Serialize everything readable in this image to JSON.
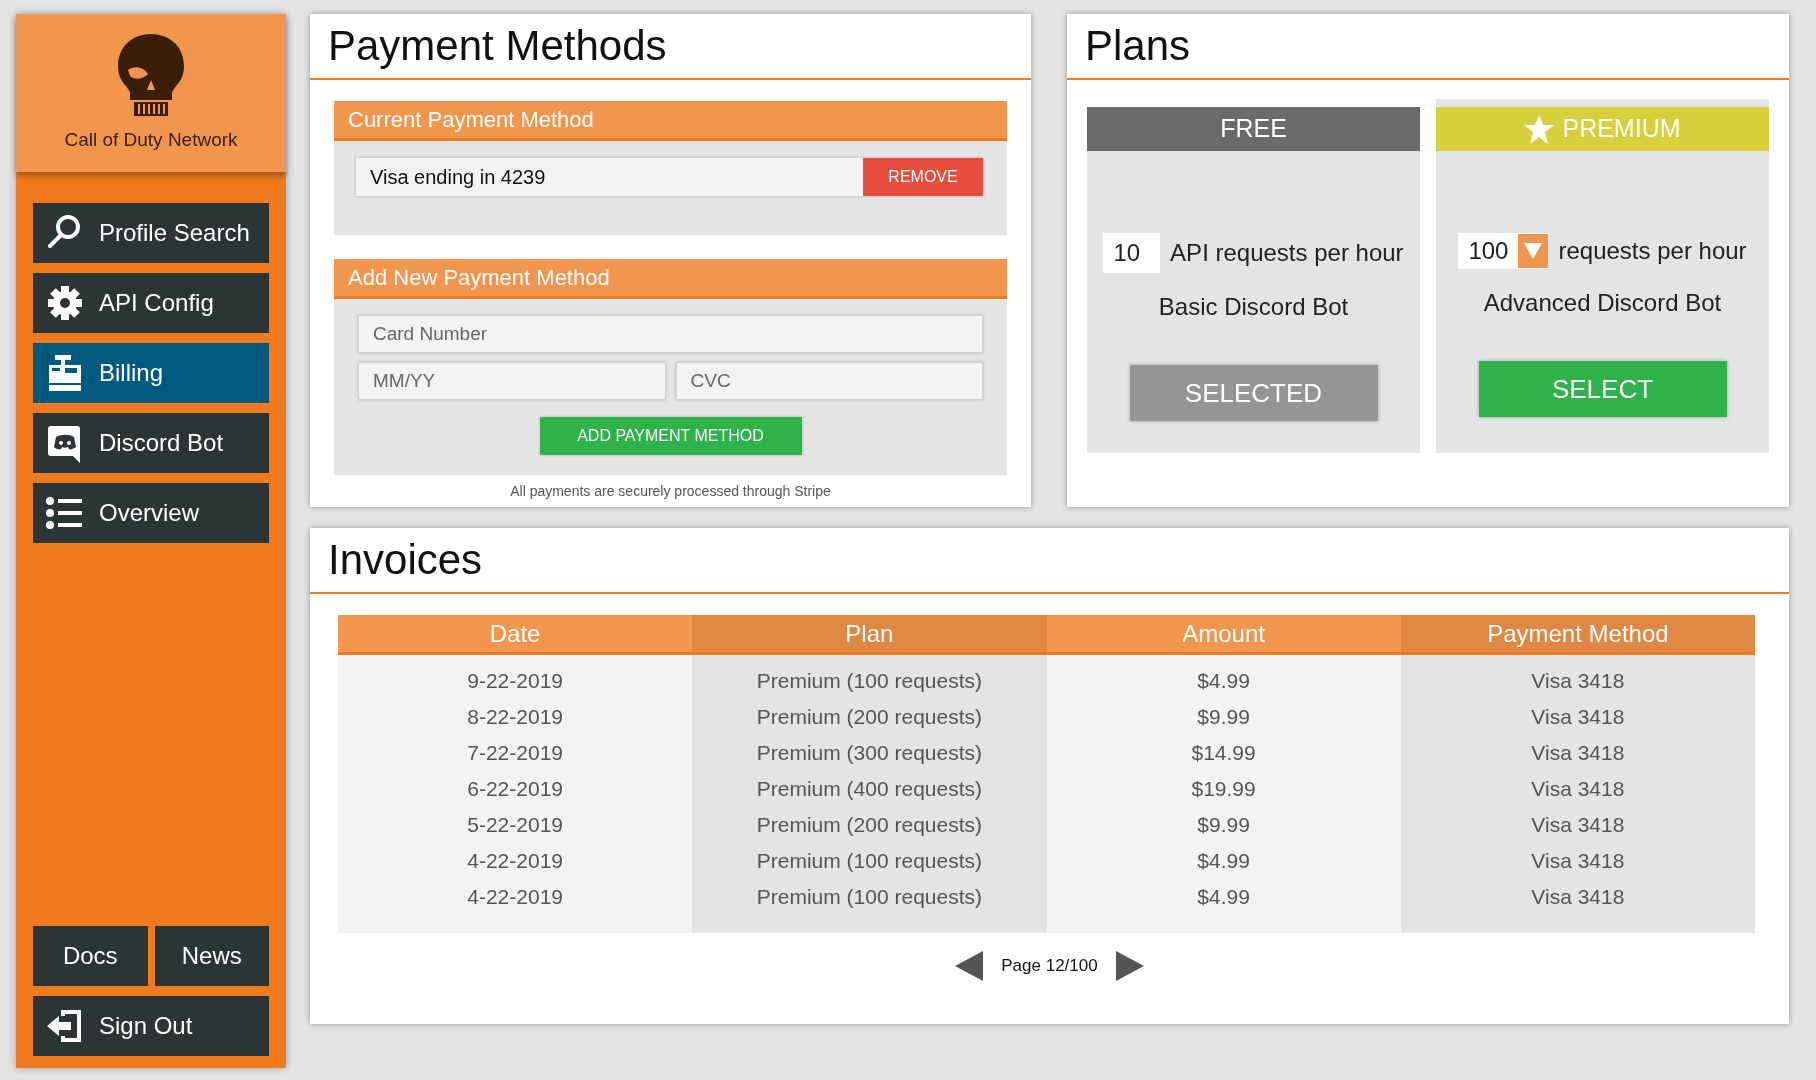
{
  "sidebar": {
    "brand": "Call of Duty Network",
    "nav_items": [
      {
        "label": "Profile Search",
        "selected": false
      },
      {
        "label": "API Config",
        "selected": false
      },
      {
        "label": "Billing",
        "selected": true
      },
      {
        "label": "Discord Bot",
        "selected": false
      },
      {
        "label": "Overview",
        "selected": false
      }
    ],
    "footer_links": [
      "Docs",
      "News"
    ],
    "sign_out": "Sign Out"
  },
  "payment_methods": {
    "title": "Payment Methods",
    "current": {
      "heading": "Current Payment Method",
      "card_text": "Visa ending in 4239",
      "remove_button": "REMOVE"
    },
    "add_new": {
      "heading": "Add New Payment Method",
      "fields": [
        {
          "placeholder": "Card Number"
        },
        {
          "placeholder": "MM/YY"
        },
        {
          "placeholder": "CVC"
        }
      ],
      "button": "ADD PAYMENT METHOD"
    },
    "note": "All payments are securely processed through Stripe"
  },
  "plans": {
    "title": "Plans",
    "tiers": [
      {
        "kind": "basic",
        "name": "FREE",
        "color": "#6b6b6b",
        "requests": "10",
        "unit_text": "API requests per hour",
        "description": "Basic Discord Bot",
        "button": "SELECTED",
        "selected": true
      },
      {
        "kind": "premium",
        "name": "PREMIUM",
        "color": "#d8cf3c",
        "requests": "100",
        "unit_text": "requests per hour",
        "description": "Advanced Discord Bot",
        "button": "SELECT",
        "selected": false
      }
    ]
  },
  "invoices": {
    "title": "Invoices",
    "columns": [
      "Date",
      "Plan",
      "Amount",
      "Payment Method"
    ],
    "rows": [
      [
        "9-22-2019",
        "Premium (100 requests)",
        "$4.99",
        "Visa 3418"
      ],
      [
        "8-22-2019",
        "Premium (200 requests)",
        "$9.99",
        "Visa 3418"
      ],
      [
        "7-22-2019",
        "Premium (300 requests)",
        "$14.99",
        "Visa 3418"
      ],
      [
        "6-22-2019",
        "Premium (400 requests)",
        "$19.99",
        "Visa 3418"
      ],
      [
        "5-22-2019",
        "Premium (200 requests)",
        "$9.99",
        "Visa 3418"
      ],
      [
        "4-22-2019",
        "Premium (100 requests)",
        "$4.99",
        "Visa 3418"
      ],
      [
        "4-22-2019",
        "Premium (100 requests)",
        "$4.99",
        "Visa 3418"
      ]
    ],
    "pagination": {
      "label": "Page 12/100"
    }
  }
}
